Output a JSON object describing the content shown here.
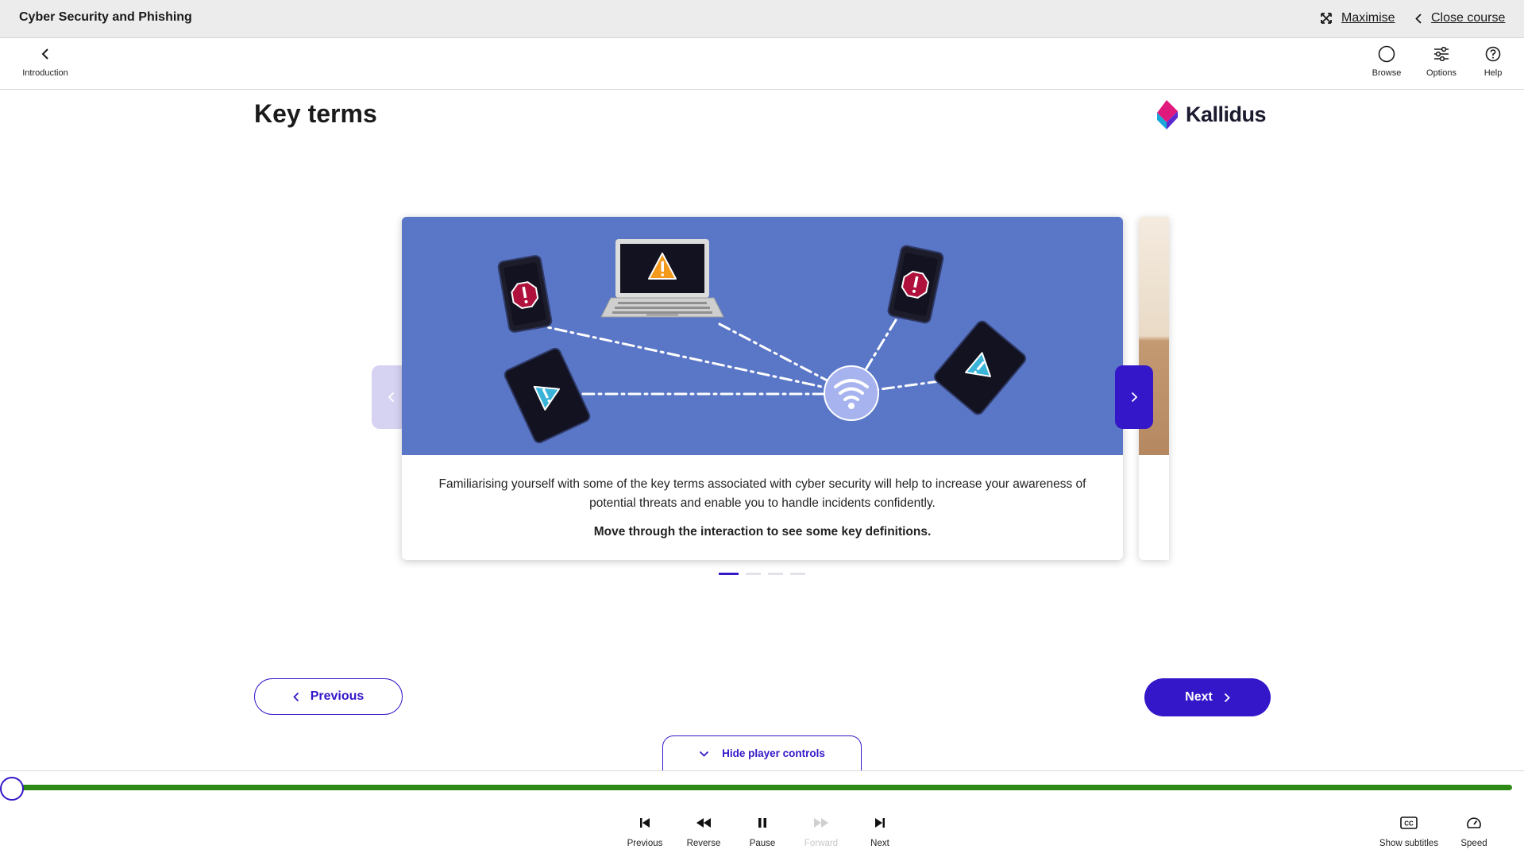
{
  "topbar": {
    "course_title": "Cyber Security and Phishing",
    "maximise_label": "Maximise",
    "close_label": "Close course"
  },
  "nav": {
    "back_label": "Introduction",
    "browse_label": "Browse",
    "options_label": "Options",
    "help_label": "Help"
  },
  "page": {
    "title": "Key terms",
    "logo_text": "Kallidus"
  },
  "carousel": {
    "description": "Familiarising yourself with some of the key terms associated with cyber security will help to increase your awareness of potential threats and enable you to handle incidents confidently.",
    "instruction": "Move through the interaction to see some key definitions.",
    "slide_count": 4,
    "active_slide": 1
  },
  "navigation": {
    "previous_label": "Previous",
    "next_label": "Next"
  },
  "player": {
    "hide_controls_label": "Hide player controls",
    "progress": 0.99,
    "controls": {
      "previous": "Previous",
      "reverse": "Reverse",
      "pause": "Pause",
      "forward": "Forward",
      "next": "Next",
      "subtitles": "Show subtitles",
      "speed": "Speed"
    }
  },
  "colors": {
    "accent": "#3417c8",
    "progress": "#2d8a16",
    "illustration_bg": "#5a76c6"
  }
}
